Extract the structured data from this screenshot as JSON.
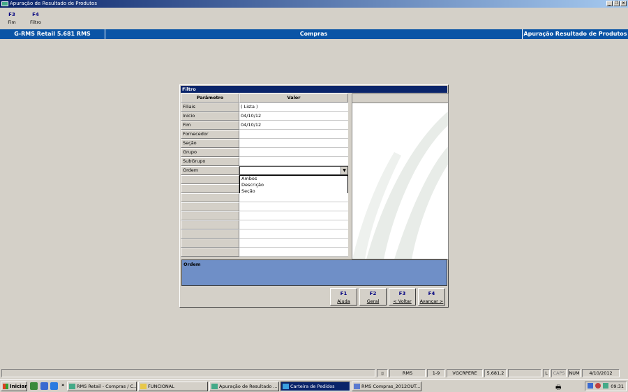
{
  "window": {
    "title": "Apuração de Resultado de Produtos"
  },
  "fkeys": [
    {
      "key": "F3",
      "label": "Fim"
    },
    {
      "key": "F4",
      "label": "Filtro"
    }
  ],
  "banner": {
    "left": "G-RMS Retail 5.681 RMS",
    "center": "Compras",
    "right": "Apuração Resultado de Produtos"
  },
  "dialog": {
    "title": "Filtro",
    "col_param": "Parâmetro",
    "col_value": "Valor",
    "rows": [
      {
        "param": "Filiais",
        "value": "( Lista )"
      },
      {
        "param": "Início",
        "value": "04/10/12"
      },
      {
        "param": "Fim",
        "value": "04/10/12"
      },
      {
        "param": "Fornecedor",
        "value": ""
      },
      {
        "param": "Seção",
        "value": ""
      },
      {
        "param": "Grupo",
        "value": ""
      },
      {
        "param": "SubGrupo",
        "value": ""
      },
      {
        "param": "Ordem",
        "value": ""
      }
    ],
    "dropdown_options": [
      "Ambos",
      "Descrição",
      "Seção"
    ],
    "description": "Ordem",
    "buttons": [
      {
        "key": "F1",
        "label": "Ajuda"
      },
      {
        "key": "F2",
        "label": "Geral"
      },
      {
        "key": "F3",
        "label": "< Voltar"
      },
      {
        "key": "F4",
        "label": "Avançar >"
      }
    ]
  },
  "statusbar": {
    "cells": [
      "RMS",
      "1-9",
      "VGCRPERE",
      "5.681.2",
      "L",
      "CAPS",
      "NUM",
      "4/10/2012"
    ]
  },
  "taskbar": {
    "start": "Iniciar",
    "tasks": [
      "RMS Retail - Compras / C...",
      "FUNCIONAL",
      "Apuração de Resultado ...",
      "Carteira de Pedidos",
      "RMS Compras_2012OUT..."
    ],
    "clock": "09:31"
  }
}
